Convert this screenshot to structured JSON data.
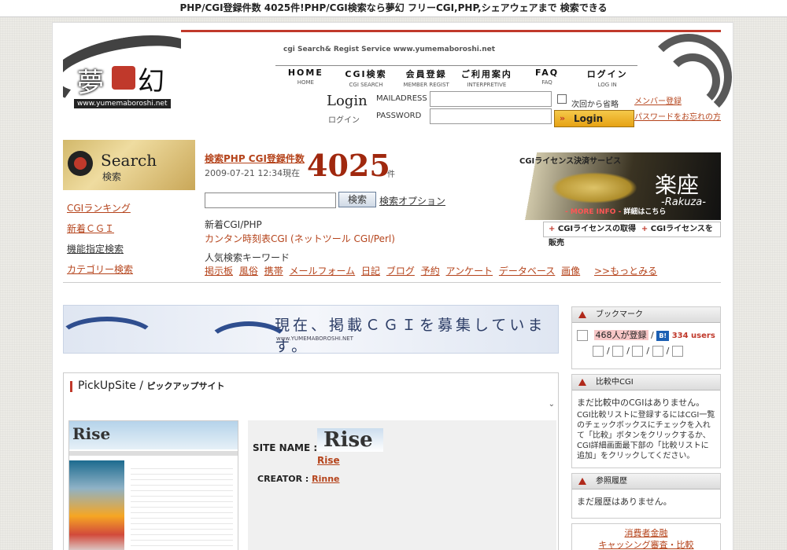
{
  "window": {
    "title": "PHP/CGI登録件数 4025件!PHP/CGI検索なら夢幻 フリーCGI,PHP,シェアウェアまで 検索できる"
  },
  "header": {
    "logo_text_left": "夢",
    "logo_text_right": "幻",
    "logo_url": "www.yumemaboroshi.net",
    "service_line": "cgi Search& Regist Service www.yumemaboroshi.net",
    "nav": [
      {
        "label": "HOME",
        "sub": "HOME"
      },
      {
        "label": "CGI検索",
        "sub": "CGI SEARCH"
      },
      {
        "label": "会員登録",
        "sub": "MEMBER REGIST"
      },
      {
        "label": "ご利用案内",
        "sub": "INTERPRETIVE"
      },
      {
        "label": "FAQ",
        "sub": "FAQ"
      },
      {
        "label": "ログイン",
        "sub": "LOG IN"
      }
    ]
  },
  "login": {
    "title": "Login",
    "subtitle": "ログイン",
    "mail_label": "MAILADRESS",
    "password_label": "PASSWORD",
    "remember_label": "次回から省略",
    "button_label": "Login",
    "member_link": "メンバー登録",
    "forgot_link": "パスワードをお忘れの方"
  },
  "search": {
    "badge_title": "Search",
    "badge_sub": "検索",
    "count_label": "検索PHP CGI登録件数",
    "count": "4025",
    "count_unit": "件",
    "date": "2009-07-21 12:34現在",
    "button_label": "検索",
    "option_link": "検索オプション",
    "new_label": "新着CGI/PHP",
    "new_item": "カンタン時刻表CGI (ネットツール CGI/Perl)",
    "keyword_label": "人気検索キーワード",
    "keywords": [
      "掲示板",
      "風俗",
      "携帯",
      "メールフォーム",
      "日記",
      "ブログ",
      "予約",
      "アンケート",
      "データベース",
      "画像"
    ],
    "more_link": ">>もっとみる",
    "left_links": [
      "CGIランキング",
      "新着ＣＧＩ",
      "機能指定検索",
      "カテゴリー検索"
    ]
  },
  "ad": {
    "header": "CGIライセンス決済サービス",
    "brand": "楽座",
    "brand_sub": "-Rakuza-",
    "more_info": "- MORE INFO -",
    "more_info_b": "詳細はこちら",
    "link1": "CGIライセンスの取得",
    "link2": "CGIライセンスを販売"
  },
  "banner": {
    "message": "現在、掲載ＣＧＩを募集しています。",
    "sub": "www.YUMEMABOROSHI.NET"
  },
  "pickup": {
    "title": "PickUpSite /",
    "title_jp": "ピックアップサイト",
    "site_name_label": "SITE NAME :",
    "site_name": "Rise",
    "creator_label": "CREATOR :",
    "creator": "Rinne"
  },
  "sidebar": {
    "bookmark_title": "ブックマーク",
    "bookmark_count": "468人が登録",
    "bookmark_users": "334 users",
    "compare_title": "比較中CGI",
    "compare_body": "まだ比較中のCGIはありません。",
    "compare_help": "CGI比較リストに登録するにはCGI一覧のチェックボックスにチェックを入れて「比較」ボタンをクリックするか、CGI詳細画面最下部の「比較リストに追加」をクリックしてください。",
    "history_title": "参照履歴",
    "history_body": "まだ履歴はありません。",
    "footer_link1": "消費者金融",
    "footer_link2": "キャッシング審査・比較"
  }
}
